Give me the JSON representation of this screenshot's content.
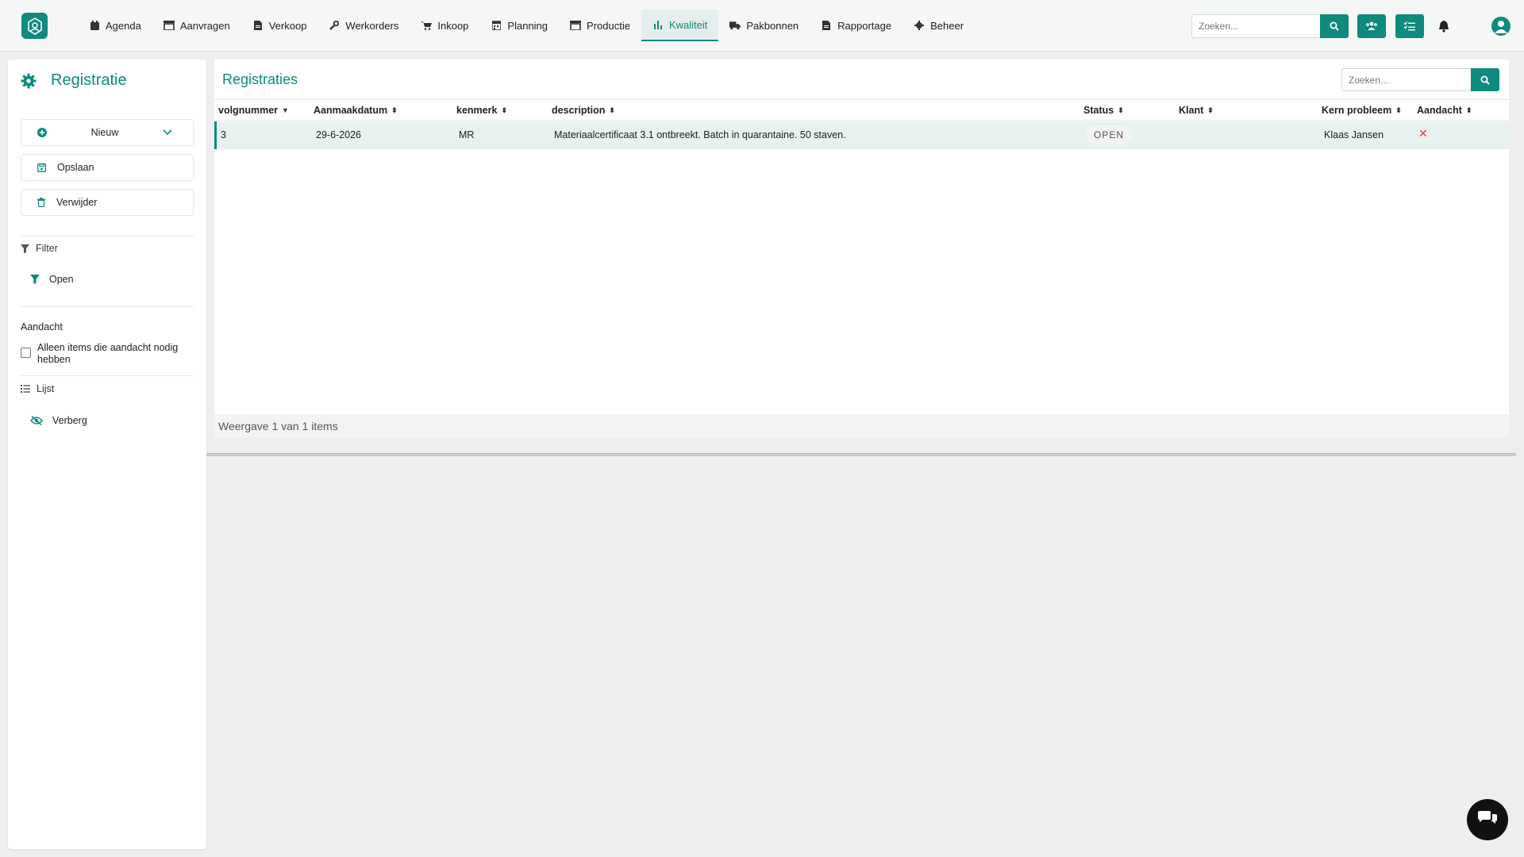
{
  "nav": {
    "items": [
      {
        "label": "Agenda",
        "icon": "calendar-icon"
      },
      {
        "label": "Aanvragen",
        "icon": "store-icon"
      },
      {
        "label": "Verkoop",
        "icon": "file-icon"
      },
      {
        "label": "Werkorders",
        "icon": "wrench-icon"
      },
      {
        "label": "Inkoop",
        "icon": "cart-icon"
      },
      {
        "label": "Planning",
        "icon": "calendar-grid-icon"
      },
      {
        "label": "Productie",
        "icon": "factory-icon"
      },
      {
        "label": "Kwaliteit",
        "icon": "bar-chart-icon"
      },
      {
        "label": "Pakbonnen",
        "icon": "truck-icon"
      },
      {
        "label": "Rapportage",
        "icon": "report-icon"
      },
      {
        "label": "Beheer",
        "icon": "gear-icon"
      }
    ],
    "active": "Kwaliteit",
    "search_placeholder": "Zoeken..."
  },
  "sidebar": {
    "title": "Registratie",
    "new_label": "Nieuw",
    "save_label": "Opslaan",
    "delete_label": "Verwijder",
    "filter_label": "Filter",
    "filter_open_label": "Open",
    "attention_label": "Aandacht",
    "attention_checkbox_label": "Alleen items die aandacht nodig hebben",
    "list_label": "Lijst",
    "hide_label": "Verberg"
  },
  "main": {
    "title": "Registraties",
    "search_placeholder": "Zoeken...",
    "columns": [
      "volgnummer",
      "Aanmaakdatum",
      "kenmerk",
      "description",
      "Status",
      "Klant",
      "Kern probleem",
      "Aandacht"
    ],
    "rows": [
      {
        "volgnummer": "3",
        "aanmaakdatum": "29-6-2026",
        "kenmerk": "MR",
        "description": "Materiaalcertificaat 3.1 ontbreekt. Batch in quarantaine. 50 staven.",
        "status": "OPEN",
        "klant": "",
        "kern_probleem": "Klaas Jansen",
        "aandacht": "✕"
      }
    ],
    "footer": "Weergave 1 van 1 items"
  },
  "colors": {
    "accent": "#0f8a7e",
    "row_selected": "#e7f1ef",
    "danger": "#e53935"
  }
}
